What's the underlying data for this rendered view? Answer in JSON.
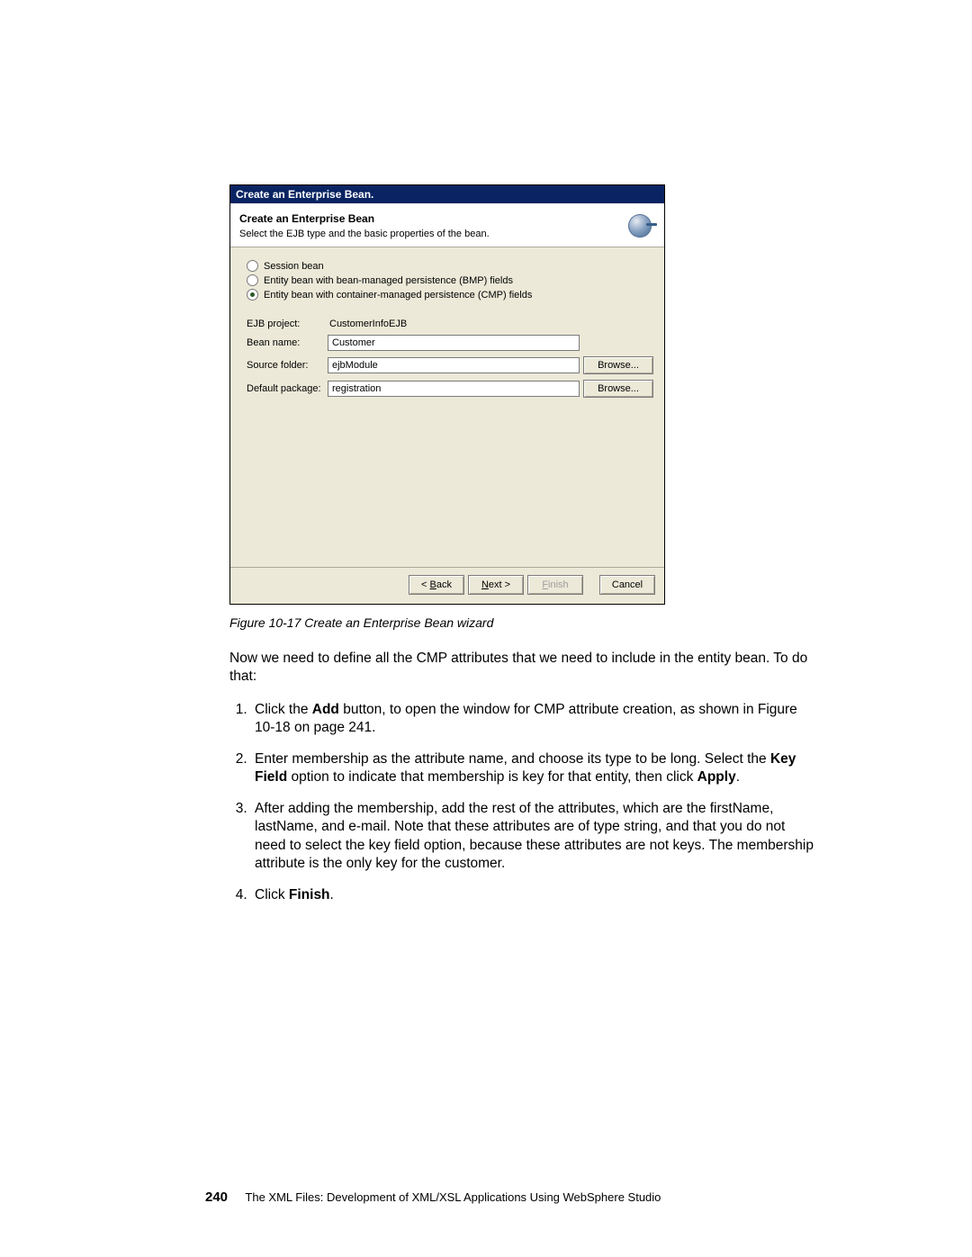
{
  "dialog": {
    "title": "Create an Enterprise Bean.",
    "header_title": "Create an Enterprise Bean",
    "header_desc": "Select the EJB type and the basic properties of the bean.",
    "radio": {
      "session": "Session bean",
      "bmp": "Entity bean with bean-managed persistence (BMP) fields",
      "cmp": "Entity bean with container-managed persistence (CMP) fields"
    },
    "labels": {
      "ejb_project": "EJB project:",
      "bean_name": "Bean name:",
      "source_folder": "Source folder:",
      "default_package": "Default package:"
    },
    "values": {
      "ejb_project": "CustomerInfoEJB",
      "bean_name": "Customer",
      "source_folder": "ejbModule",
      "default_package": "registration"
    },
    "buttons": {
      "browse": "Browse...",
      "back_pre": "< ",
      "back_u": "B",
      "back_post": "ack",
      "next_u": "N",
      "next_post": "ext >",
      "finish_u": "F",
      "finish_post": "inish",
      "cancel": "Cancel"
    }
  },
  "doc": {
    "caption": "Figure 10-17   Create an Enterprise Bean wizard",
    "intro": "Now we need to define all the CMP attributes that we need to include in the entity bean. To do that:",
    "steps": {
      "s1a": "Click the ",
      "s1b_bold": "Add",
      "s1c": " button, to open the window for CMP attribute creation, as shown in Figure 10-18 on page 241.",
      "s2a": "Enter membership as the attribute name, and choose its type to be long. Select the ",
      "s2b_bold": "Key Field",
      "s2c": " option to indicate that membership is key for that entity, then click ",
      "s2d_bold": "Apply",
      "s2e": ".",
      "s3": "After adding the membership, add the rest of the attributes, which are the firstName, lastName, and e-mail. Note that these attributes are of type string, and that you do not need to select the key field option, because these attributes are not keys. The membership attribute is the only key for the customer.",
      "s4a": "Click ",
      "s4b_bold": "Finish",
      "s4c": "."
    }
  },
  "footer": {
    "page": "240",
    "book": "The XML Files:  Development of XML/XSL Applications Using WebSphere Studio"
  }
}
